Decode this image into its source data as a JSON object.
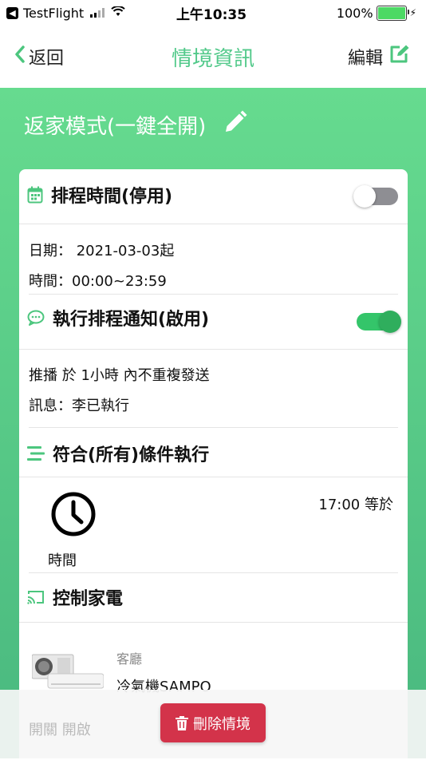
{
  "status_bar": {
    "carrier": "TestFlight",
    "time": "上午10:35",
    "battery": "100%"
  },
  "nav": {
    "back_label": "返回",
    "title": "情境資訊",
    "edit_label": "編輯"
  },
  "scene": {
    "name": "返家模式(一鍵全開)"
  },
  "schedule": {
    "title": "排程時間(停用)",
    "enabled": false,
    "date_line": "日期： 2021-03-03起",
    "time_line": "時間：00:00~23:59"
  },
  "notify": {
    "title": "執行排程通知(啟用)",
    "enabled": true,
    "push_line": "推播  於  1小時 內不重複發送",
    "message_line": "訊息：李已執行"
  },
  "conditions": {
    "title": "符合(所有)條件執行",
    "items": [
      {
        "label": "時間",
        "value": "17:00 等於"
      }
    ]
  },
  "appliances": {
    "title": "控制家電",
    "items": [
      {
        "room": "客廳",
        "name": "冷氣機SAMPO",
        "status": "開關 開啟"
      }
    ]
  },
  "actions": {
    "delete_label": "刪除情境"
  },
  "colors": {
    "accent": "#52c98a",
    "delete": "#d3334a",
    "toggle_on": "#34c56a",
    "toggle_off": "#8e8e93"
  }
}
